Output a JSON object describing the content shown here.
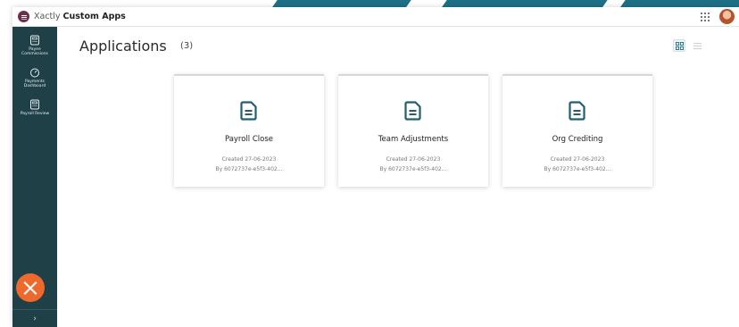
{
  "brand": {
    "name": "Xactly",
    "app": "Custom Apps"
  },
  "sidebar": {
    "items": [
      {
        "label_line1": "Payee",
        "label_line2": "Commissions",
        "icon": "calculator-icon"
      },
      {
        "label_line1": "Payments",
        "label_line2": "Dashboard",
        "icon": "gauge-icon"
      },
      {
        "label_line1": "Payroll Review",
        "label_line2": "",
        "icon": "calculator-icon"
      }
    ],
    "expand_label": "›"
  },
  "main": {
    "title": "Applications",
    "count": "(3)",
    "cards": [
      {
        "name": "Payroll Close",
        "created": "Created 27-06-2023",
        "by": "By 6072737e-e5f3-402..."
      },
      {
        "name": "Team Adjustments",
        "created": "Created 27-06-2023",
        "by": "By 6072737e-e5f3-402..."
      },
      {
        "name": "Org Crediting",
        "created": "Created 27-06-2023",
        "by": "By 6072737e-e5f3-402..."
      }
    ]
  },
  "colors": {
    "sidebar": "#1f4047",
    "accent": "#1f6f86",
    "brand_logo": "#6b2f4b",
    "x_logo": "#ee6a2c"
  }
}
